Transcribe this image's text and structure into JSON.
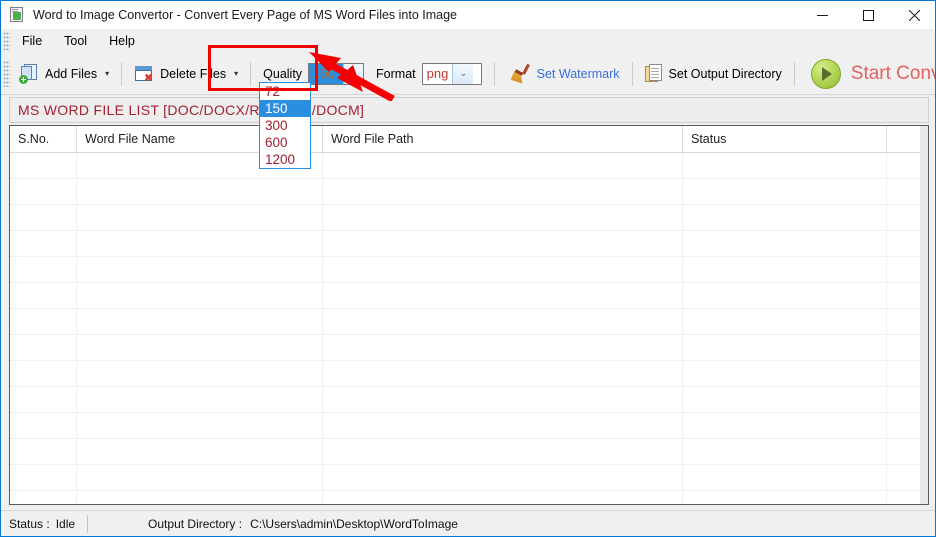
{
  "window": {
    "title": "Word to Image Convertor - Convert Every Page of MS Word Files into Image",
    "icon": "app-document-icon",
    "controls": {
      "minimize": "—",
      "maximize": "☐",
      "close": "✕"
    }
  },
  "menu": {
    "items": [
      {
        "label": "File"
      },
      {
        "label": "Tool"
      },
      {
        "label": "Help"
      }
    ]
  },
  "toolbar": {
    "add_files": {
      "label": "Add Files",
      "caret": "▾",
      "icon": "add-files-icon"
    },
    "delete_files": {
      "label": "Delete Files",
      "caret": "▾",
      "icon": "delete-files-icon"
    },
    "quality": {
      "label": "Quality",
      "value": "150",
      "caret": "⌄",
      "options": [
        "72",
        "150",
        "300",
        "600",
        "1200"
      ],
      "selected_index": 1,
      "expanded": true
    },
    "format": {
      "label": "Format",
      "value": "png",
      "caret": "⌄"
    },
    "set_watermark": {
      "label": "Set Watermark",
      "icon": "broom-icon"
    },
    "set_output_directory": {
      "label": "Set Output Directory",
      "icon": "clipboard-icon"
    },
    "start_conversion": {
      "label": "Start Conversion",
      "icon": "play-icon"
    }
  },
  "list_section": {
    "header": "MS WORD FILE LIST [DOC/DOCX/RTF/DOT/DOCM]"
  },
  "grid": {
    "columns": [
      "S.No.",
      "Word File Name",
      "Word File Path",
      "Status",
      ""
    ],
    "rows": []
  },
  "statusbar": {
    "status_label": "Status :",
    "status_value": "Idle",
    "output_label": "Output Directory :",
    "output_value": "C:\\Users\\admin\\Desktop\\WordToImage"
  },
  "colors": {
    "accent_blue": "#2b8fe0",
    "header_red": "#a32232",
    "start_red": "#e2615e",
    "watermark_blue": "#3a6fd8",
    "annotation_red": "#f50000",
    "window_border": "#0078d7"
  }
}
